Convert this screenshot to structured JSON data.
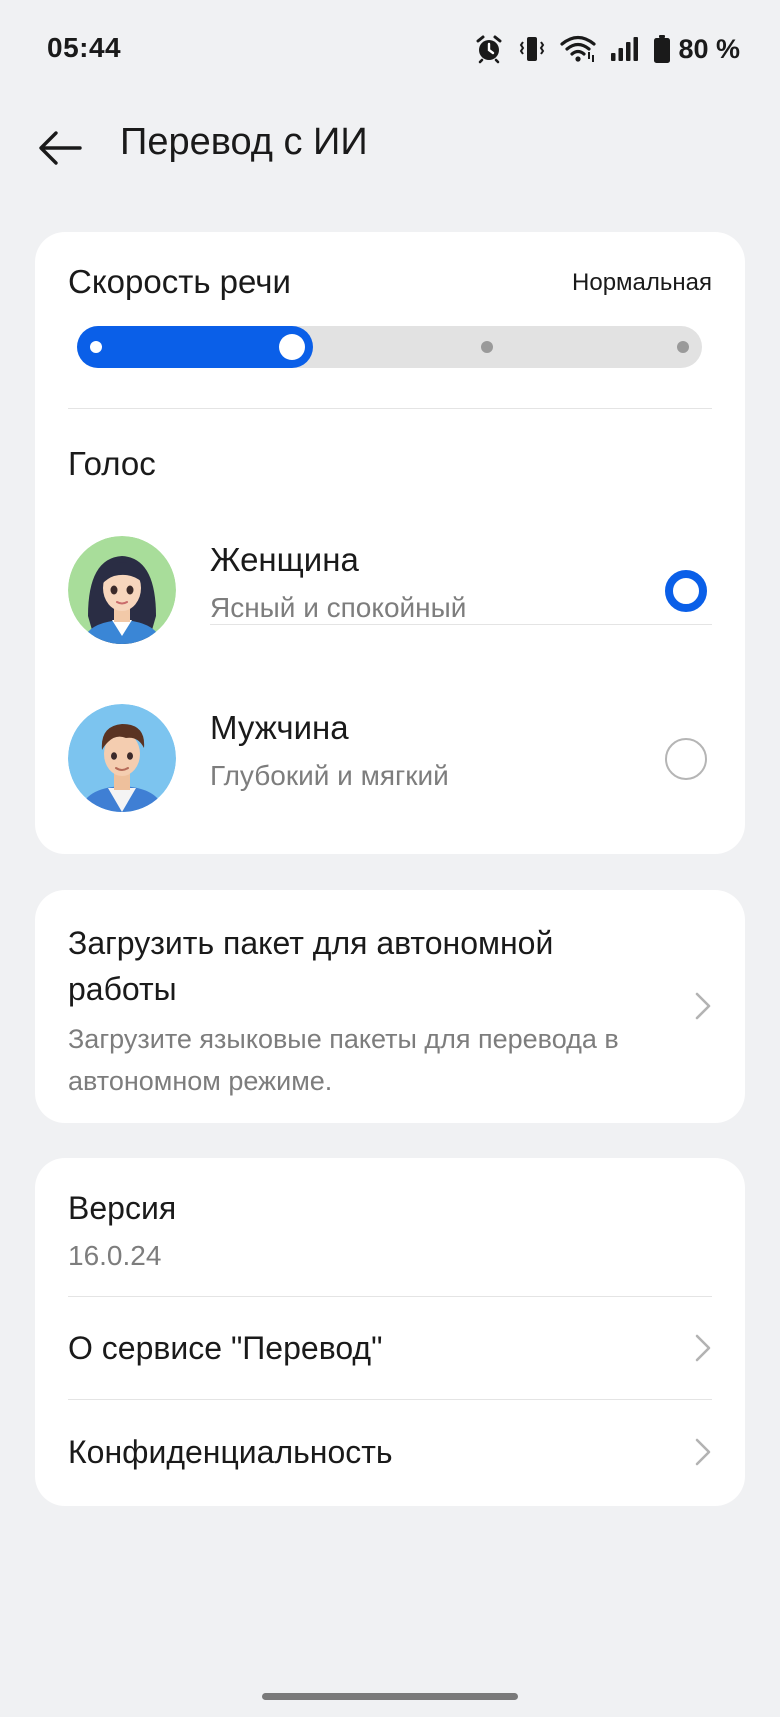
{
  "status_bar": {
    "time": "05:44",
    "battery": "80 %",
    "icons": [
      "alarm-icon",
      "vibrate-icon",
      "wifi-icon",
      "signal-icon",
      "battery-icon"
    ]
  },
  "header": {
    "title": "Перевод с ИИ",
    "back_icon": "arrow-left-icon"
  },
  "speech_speed": {
    "label": "Скорость речи",
    "value": "Нормальная",
    "levels": 4,
    "selected_level": 2
  },
  "voice": {
    "heading": "Голос",
    "options": [
      {
        "name": "Женщина",
        "description": "Ясный и спокойный",
        "selected": true
      },
      {
        "name": "Мужчина",
        "description": "Глубокий и мягкий",
        "selected": false
      }
    ]
  },
  "offline": {
    "title": "Загрузить пакет для автономной работы",
    "description": "Загрузите языковые пакеты для перевода в автономном режиме."
  },
  "info": {
    "version_label": "Версия",
    "version_value": "16.0.24",
    "about_label": "О сервисе \"Перевод\"",
    "privacy_label": "Конфиденциальность"
  },
  "colors": {
    "accent": "#0a5fe8",
    "background": "#f0f1f3",
    "card": "#ffffff",
    "secondary_text": "#7d7d7d"
  }
}
